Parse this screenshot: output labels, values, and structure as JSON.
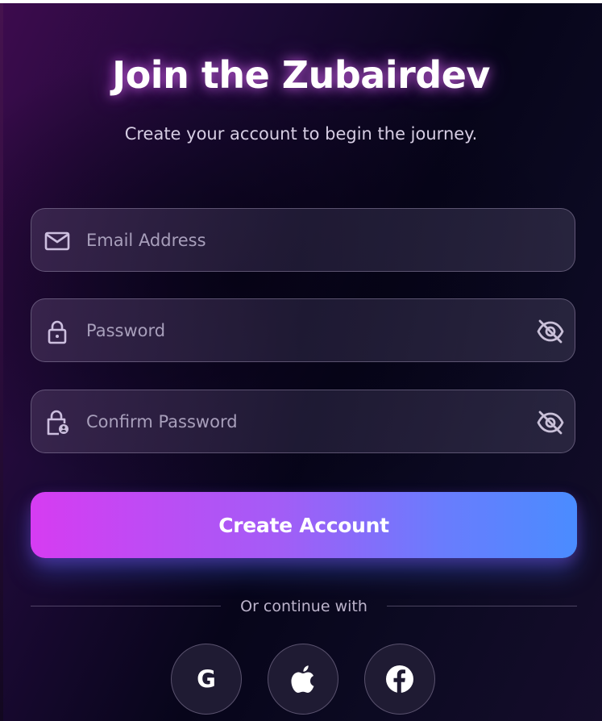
{
  "header": {
    "title": "Join the Zubairdev",
    "subtitle": "Create your account to begin the journey."
  },
  "form": {
    "email": {
      "placeholder": "Email Address",
      "value": "",
      "icon": "mail-icon"
    },
    "password": {
      "placeholder": "Password",
      "value": "",
      "icon": "lock-icon",
      "toggle_icon": "eye-off-icon"
    },
    "confirm_password": {
      "placeholder": "Confirm Password",
      "value": "",
      "icon": "lock-person-icon",
      "toggle_icon": "eye-off-icon"
    },
    "submit_label": "Create Account"
  },
  "social": {
    "divider_text": "Or continue with",
    "providers": [
      {
        "name": "google",
        "label": "G",
        "icon": "google-icon"
      },
      {
        "name": "apple",
        "icon": "apple-icon"
      },
      {
        "name": "facebook",
        "icon": "facebook-icon"
      }
    ]
  },
  "colors": {
    "button_gradient_start": "#d63cf2",
    "button_gradient_end": "#4a8cff",
    "title_glow": "#e86eff",
    "background_dark": "#07051a",
    "background_purple": "#3d0b4e"
  }
}
